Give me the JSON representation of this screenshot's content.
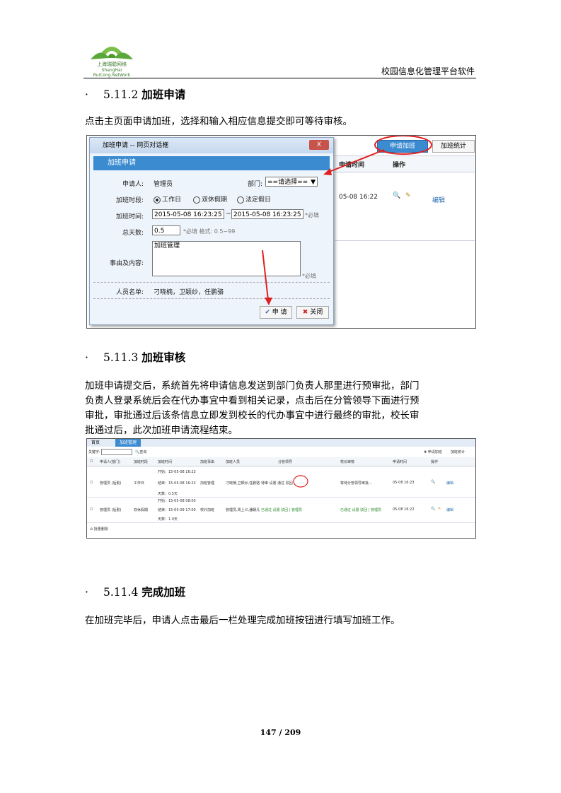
{
  "header": {
    "logo_text_cn": "上海瑞聪网络",
    "logo_text_en": "ShangHai RuiCong.NetWork",
    "title": "校园信息化管理平台软件"
  },
  "sections": [
    {
      "bullet": "·",
      "number": "5.11.2",
      "title": "加班申请",
      "paragraph": "点击主页面申请加班，选择和输入相应信息提交即可等待审核。"
    },
    {
      "bullet": "·",
      "number": "5.11.3",
      "title": "加班审核",
      "paragraph_lines": [
        "加班申请提交后，系统首先将申请信息发送到部门负责人那里进行预审批，部门",
        "负责人登录系统后会在代办事宜中看到相关记录，点击后在分管领导下面进行预",
        "审批，审批通过后该条信息立即发到校长的代办事宜中进行最终的审批，校长审",
        "批通过后，此次加班申请流程结束。"
      ]
    },
    {
      "bullet": "·",
      "number": "5.11.4",
      "title": "完成加班",
      "paragraph": "在加班完毕后，申请人点击最后一栏处理完成加班按钮进行填写加班工作。"
    }
  ],
  "screenshot1": {
    "window_title": "加班申请 -- 网页对话框",
    "close_label": "X",
    "form_title": "加班申请",
    "applicant_label": "申请人:",
    "applicant_value": "管理员",
    "dept_label": "部门:",
    "dept_value": "==请选择==",
    "period_label": "加班时段:",
    "period_options": [
      "工作日",
      "双休假期",
      "法定假日"
    ],
    "time_label": "加班时间:",
    "time_start": "2015-05-08 16:23:25",
    "time_sep": "~",
    "time_end": "2015-05-08 16:23:25",
    "required": "*必填",
    "days_label": "总天数:",
    "days_value": "0.5",
    "days_hint": "*必填 格式: 0.5~99",
    "reason_label": "事由及内容:",
    "reason_value": "加班管理",
    "staff_label": "人员名单:",
    "staff_value": "刁晓楠，卫颖纱，任鹏骆",
    "submit_label": "申 请",
    "cancel_label": "关闭",
    "bg_apply_button": "申请加班",
    "bg_stats_button": "加班统计",
    "bg_col_time": "申请时间",
    "bg_col_action": "操作",
    "bg_time": "05-08 16:22",
    "bg_edit": "编辑"
  },
  "screenshot2": {
    "tabs": [
      "首页",
      "加班管理"
    ],
    "search_label": "关键字:",
    "search_button": "查询",
    "apply_button": "申请加班",
    "stats_button": "加班统计",
    "columns": [
      "申请人(部门)",
      "加班时段",
      "加班时间",
      "加班事由",
      "加班人员",
      "分管领导",
      "校长审核",
      "申请时间",
      "操作"
    ],
    "rows": [
      {
        "applicant": "管理员 (后勤)",
        "period": "工作日",
        "time_lines": [
          "开始：15-05-08 16:23",
          "结束：15-05-08 16:23",
          "天数：0.5天"
        ],
        "reason": "加班管理",
        "staff": "刁晓楠,卫颖纱,任鹏骆",
        "leader": "待审 设置 通过 驳回",
        "principal": "等待分管领导审批...",
        "time": "05-08 16:23",
        "edit": "编辑"
      },
      {
        "applicant": "管理员 (后勤)",
        "period": "双休假期",
        "time_lines": [
          "开始：15-05-08 08:00",
          "结束：15-05-09 17:00",
          "天数：1.0天"
        ],
        "reason": "校外加班",
        "staff": "管理员,周上义,潘朝凡",
        "leader": "已通过 设置 驳回 | 管理员",
        "principal": "已通过 设置 驳回 | 管理员",
        "time": "05-08 16:22",
        "edit": "编辑"
      }
    ],
    "batch_delete": "批量删除"
  },
  "page_number": "147 / 209"
}
